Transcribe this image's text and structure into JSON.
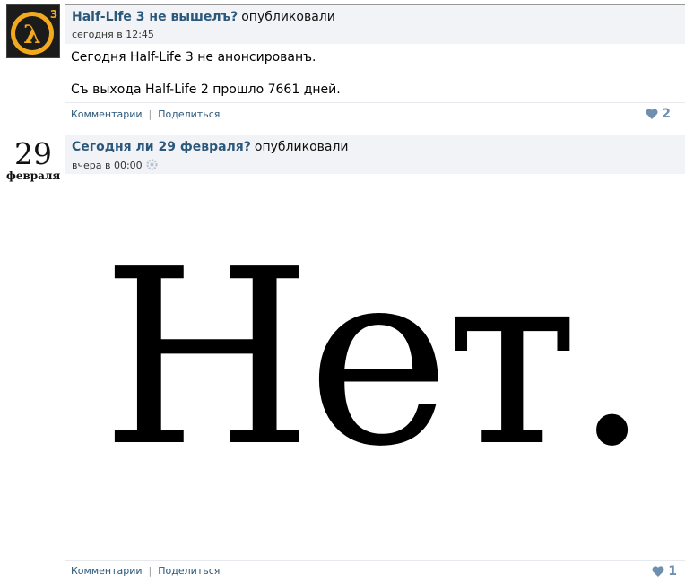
{
  "posts": [
    {
      "avatar_icon": "half-life-3-logo-icon",
      "title": "Half-Life 3 не вышелъ?",
      "title_suffix": "опубликовали",
      "time": "сегодня в 12:45",
      "lines": [
        "Сегодня Half-Life 3 не анонсированъ.",
        "Съ выхода Half-Life 2 прошло 7661 дней."
      ],
      "comments_label": "Комментарии",
      "share_label": "Поделиться",
      "likes": "2"
    },
    {
      "avatar_day": "29",
      "avatar_month": "февраля",
      "title": "Сегодня ли 29 февраля?",
      "title_suffix": "опубликовали",
      "time": "вчера в 00:00",
      "image_text": "Нет.",
      "comments_label": "Комментарии",
      "share_label": "Поделиться",
      "likes": "1"
    }
  ],
  "colors": {
    "link": "#2b587a",
    "header_bg": "#f1f3f6",
    "like": "#6f8fb1"
  }
}
